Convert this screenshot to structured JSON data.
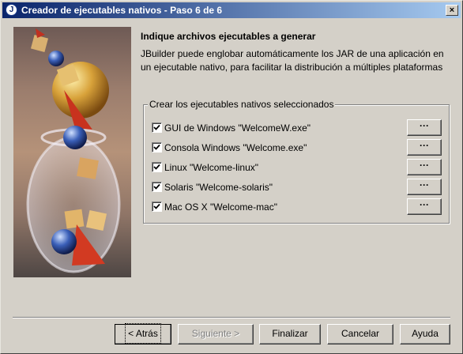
{
  "window": {
    "title": "Creador de ejecutables nativos - Paso 6 de 6",
    "close_glyph": "×"
  },
  "content": {
    "heading": "Indique archivos ejecutables a generar",
    "description": "JBuilder puede englobar automáticamente los JAR de una aplicación en un ejecutable nativo, para facilitar la distribución a múltiples plataformas",
    "group_label": "Crear los ejecutables nativos seleccionados",
    "options": [
      {
        "label": "GUI de Windows \"WelcomeW.exe\"",
        "checked": true,
        "browse": "···"
      },
      {
        "label": "Consola Windows \"Welcome.exe\"",
        "checked": true,
        "browse": "···"
      },
      {
        "label": "Linux \"Welcome-linux\"",
        "checked": true,
        "browse": "···"
      },
      {
        "label": "Solaris \"Welcome-solaris\"",
        "checked": true,
        "browse": "···"
      },
      {
        "label": "Mac OS X \"Welcome-mac\"",
        "checked": true,
        "browse": "···"
      }
    ]
  },
  "footer": {
    "back": "< Atrás",
    "next": "Siguiente >",
    "finish": "Finalizar",
    "cancel": "Cancelar",
    "help": "Ayuda"
  },
  "colors": {
    "titlebar_start": "#0a246a",
    "titlebar_end": "#a6caf0",
    "face": "#d4d0c8"
  },
  "icons": {
    "title": "jbuilder-icon",
    "check": "checkmark-icon"
  }
}
